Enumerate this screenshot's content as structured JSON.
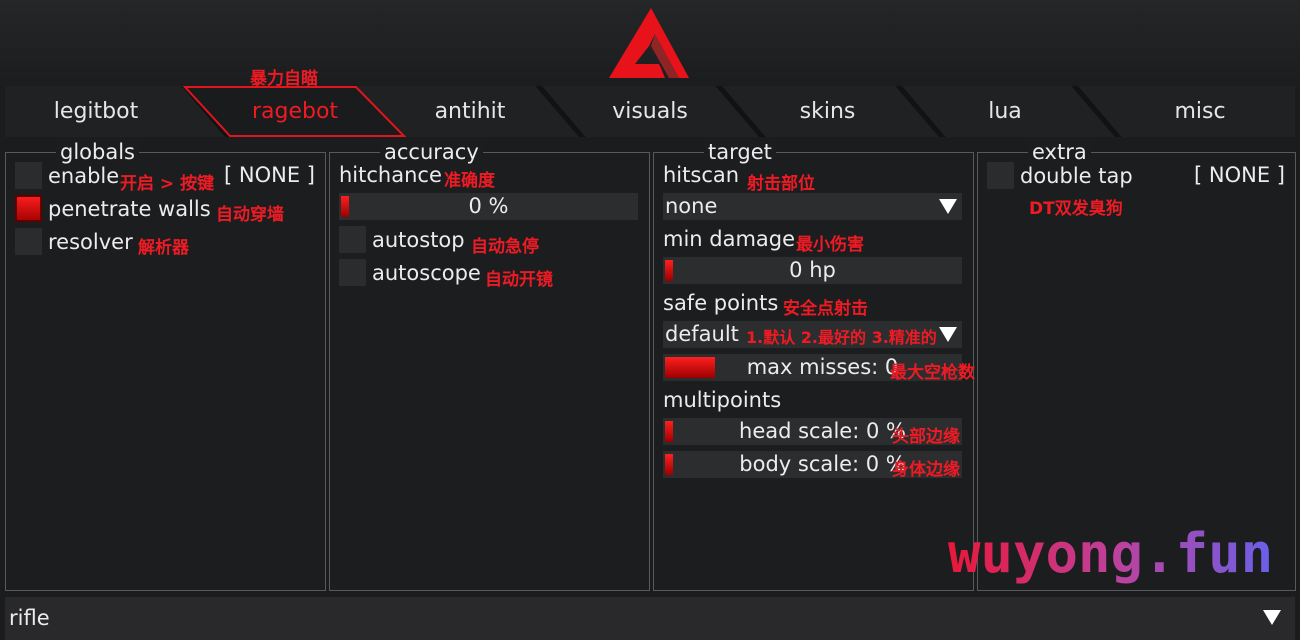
{
  "colors": {
    "accent": "#ee1b24",
    "panel_bg": "#1c1d1f",
    "border": "#58595b",
    "text": "#ececec"
  },
  "logo": {
    "icon": "brand-triangle-logo"
  },
  "tabs": [
    {
      "label": "legitbot",
      "active": false
    },
    {
      "label": "ragebot",
      "active": true
    },
    {
      "label": "antihit",
      "active": false
    },
    {
      "label": "visuals",
      "active": false
    },
    {
      "label": "skins",
      "active": false
    },
    {
      "label": "lua",
      "active": false
    },
    {
      "label": "misc",
      "active": false
    }
  ],
  "annotations": {
    "ragebot": "暴力自瞄",
    "enable": "开启 > 按键",
    "penetrate": "自动穿墙",
    "resolver": "解析器",
    "hitchance": "准确度",
    "autostop": "自动急停",
    "autoscope": "自动开镜",
    "hitscan": "射击部位",
    "min_damage": "最小伤害",
    "safe_points": "安全点射击",
    "safe_points_options": "1.默认 2.最好的 3.精准的",
    "max_misses": "最大空枪数",
    "head_scale": "头部边缘",
    "body_scale": "身体边缘",
    "double_tap": "DT双发臭狗"
  },
  "globals": {
    "title": "globals",
    "enable": {
      "label": "enable",
      "checked": false,
      "key": "[ NONE ]"
    },
    "penetrate_walls": {
      "label": "penetrate walls",
      "checked": true
    },
    "resolver": {
      "label": "resolver",
      "checked": false
    }
  },
  "accuracy": {
    "title": "accuracy",
    "hitchance": {
      "label": "hitchance",
      "value_text": "0 %",
      "fraction": 0.0
    },
    "autostop": {
      "label": "autostop",
      "checked": false
    },
    "autoscope": {
      "label": "autoscope",
      "checked": false
    }
  },
  "target": {
    "title": "target",
    "hitscan": {
      "label": "hitscan",
      "selected": "none"
    },
    "min_damage": {
      "label": "min damage",
      "value_text": "0 hp",
      "fraction": 0.0
    },
    "safe_points": {
      "label": "safe points",
      "selected": "default"
    },
    "max_misses": {
      "value_text": "max misses: 0",
      "fraction": 0.17
    },
    "multipoints": {
      "label": "multipoints"
    },
    "head_scale": {
      "value_text": "head scale: 0 %",
      "fraction": 0.0
    },
    "body_scale": {
      "value_text": "body scale: 0 %",
      "fraction": 0.0
    }
  },
  "extra": {
    "title": "extra",
    "double_tap": {
      "label": "double tap",
      "checked": false,
      "key": "[ NONE ]"
    }
  },
  "weapon_select": {
    "selected": "rifle"
  },
  "watermark": "wuyong.fun"
}
